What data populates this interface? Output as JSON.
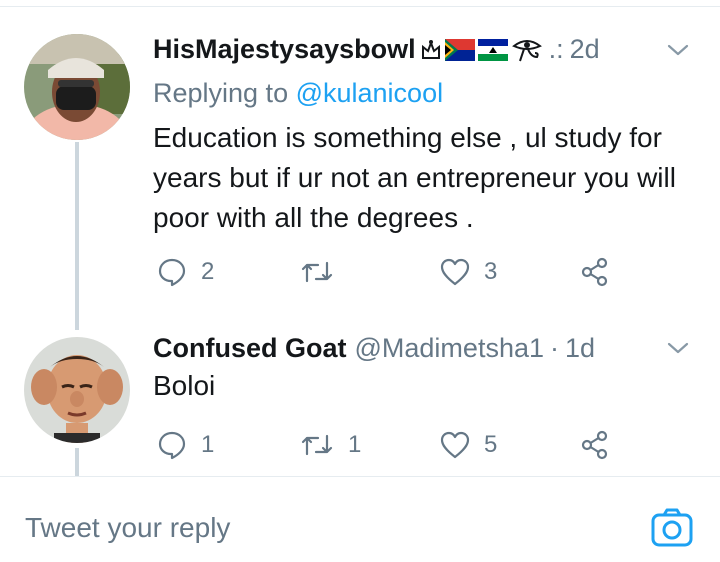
{
  "tweets": [
    {
      "name": "HisMajestysaysbowl",
      "time_prefix": ".:",
      "time": "2d",
      "replying_prefix": "Replying to ",
      "replying_to": "@kulanicool",
      "text": "Education is something else , ul study for years but if ur not an entrepreneur you will poor with all the degrees .",
      "reply_count": "2",
      "retweet_count": "",
      "like_count": "3"
    },
    {
      "name": "Confused Goat",
      "handle": "@Madimetsha1",
      "sep": "·",
      "time": "1d",
      "text": "Boloi",
      "reply_count": "1",
      "retweet_count": "1",
      "like_count": "5"
    }
  ],
  "composer": {
    "placeholder": "Tweet your reply"
  },
  "colors": {
    "accent": "#1da1f2",
    "secondary_text": "#657786",
    "icon": "#657786",
    "divider": "#e6ecf0"
  }
}
